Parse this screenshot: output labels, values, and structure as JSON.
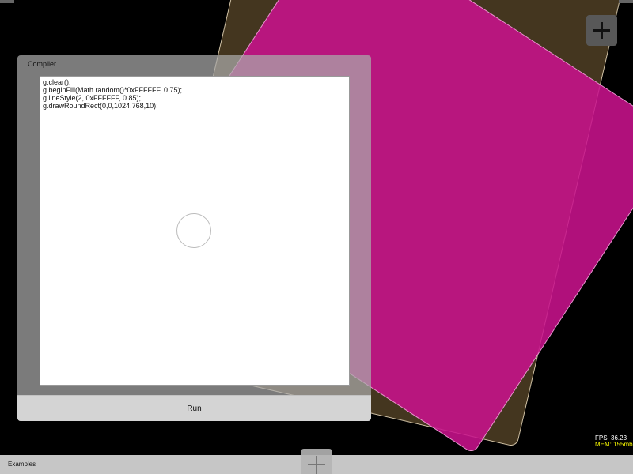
{
  "compiler": {
    "title": "Compiler",
    "code_lines": [
      "g.clear();",
      "g.beginFill(Math.random()*0xFFFFFF, 0.75);",
      "g.lineStyle(2, 0xFFFFFF, 0.85);",
      "g.drawRoundRect(0,0,1024,768,10);"
    ],
    "run_label": "Run"
  },
  "stats": {
    "fps": "FPS: 36.23",
    "mem": "MEM: 155mb"
  },
  "bottom_bar": {
    "examples_label": "Examples"
  },
  "colors": {
    "shape_magenta": "#c8128c",
    "shape_olive": "#504024",
    "mem_text": "#ffff00",
    "fps_text": "#ffffff"
  },
  "icons": {
    "add_top": "plus-icon",
    "add_bottom": "plus-icon"
  }
}
